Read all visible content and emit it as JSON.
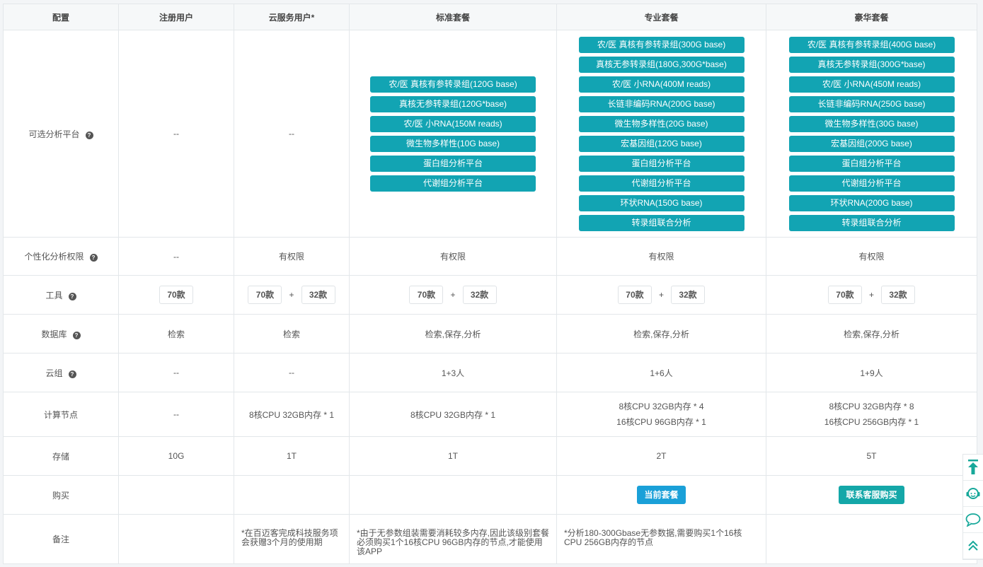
{
  "columns": [
    "配置",
    "注册用户",
    "云服务用户*",
    "标准套餐",
    "专业套餐",
    "豪华套餐"
  ],
  "rows": {
    "platform": {
      "label": "可选分析平台",
      "registered": "--",
      "cloud": "--",
      "standard": [
        "农/医 真核有参转录组(120G base)",
        "真核无参转录组(120G*base)",
        "农/医 小RNA(150M reads)",
        "微生物多样性(10G base)",
        "蛋白组分析平台",
        "代谢组分析平台"
      ],
      "pro": [
        "农/医 真核有参转录组(300G base)",
        "真核无参转录组(180G,300G*base)",
        "农/医 小RNA(400M reads)",
        "长链非编码RNA(200G base)",
        "微生物多样性(20G base)",
        "宏基因组(120G base)",
        "蛋白组分析平台",
        "代谢组分析平台",
        "环状RNA(150G base)",
        "转录组联合分析"
      ],
      "luxury": [
        "农/医 真核有参转录组(400G base)",
        "真核无参转录组(300G*base)",
        "农/医 小RNA(450M reads)",
        "长链非编码RNA(250G base)",
        "微生物多样性(30G base)",
        "宏基因组(200G base)",
        "蛋白组分析平台",
        "代谢组分析平台",
        "环状RNA(200G base)",
        "转录组联合分析"
      ]
    },
    "custom": {
      "label": "个性化分析权限",
      "registered": "--",
      "cloud": "有权限",
      "standard": "有权限",
      "pro": "有权限",
      "luxury": "有权限"
    },
    "tools": {
      "label": "工具",
      "a": "70款",
      "plus": "+",
      "b": "32款"
    },
    "database": {
      "label": "数据库",
      "registered": "检索",
      "cloud": "检索",
      "standard": "检索,保存,分析",
      "pro": "检索,保存,分析",
      "luxury": "检索,保存,分析"
    },
    "group": {
      "label": "云组",
      "registered": "--",
      "cloud": "--",
      "standard": "1+3人",
      "pro": "1+6人",
      "luxury": "1+9人"
    },
    "compute": {
      "label": "计算节点",
      "registered": "--",
      "cloud": "8核CPU 32GB内存 * 1",
      "standard": "8核CPU 32GB内存 * 1",
      "pro1": "8核CPU 32GB内存 * 4",
      "pro2": "16核CPU 96GB内存 * 1",
      "lux1": "8核CPU 32GB内存 * 8",
      "lux2": "16核CPU 256GB内存 * 1"
    },
    "storage": {
      "label": "存储",
      "registered": "10G",
      "cloud": "1T",
      "standard": "1T",
      "pro": "2T",
      "luxury": "5T"
    },
    "buy": {
      "label": "购买",
      "pro": "当前套餐",
      "luxury": "联系客服购买"
    },
    "notes": {
      "label": "备注",
      "cloud": "*在百迈客完成科技服务项会获赠3个月的使用期",
      "standard": "*由于无参数组装需要消耗较多内存,因此该级别套餐必须购买1个16核CPU 96GB内存的节点,才能使用该APP",
      "pro": "*分析180-300Gbase无参数据,需要购买1个16核CPU 256GB内存的节点"
    }
  },
  "help_glyph": "?",
  "colors": {
    "platform_button": "#12a4b3",
    "current_plan": "#1aa0d8",
    "contact": "#14a7a8"
  },
  "sidebar_icons": [
    "back-to-top-icon",
    "customer-service-icon",
    "chat-icon",
    "double-chevron-up-icon"
  ]
}
